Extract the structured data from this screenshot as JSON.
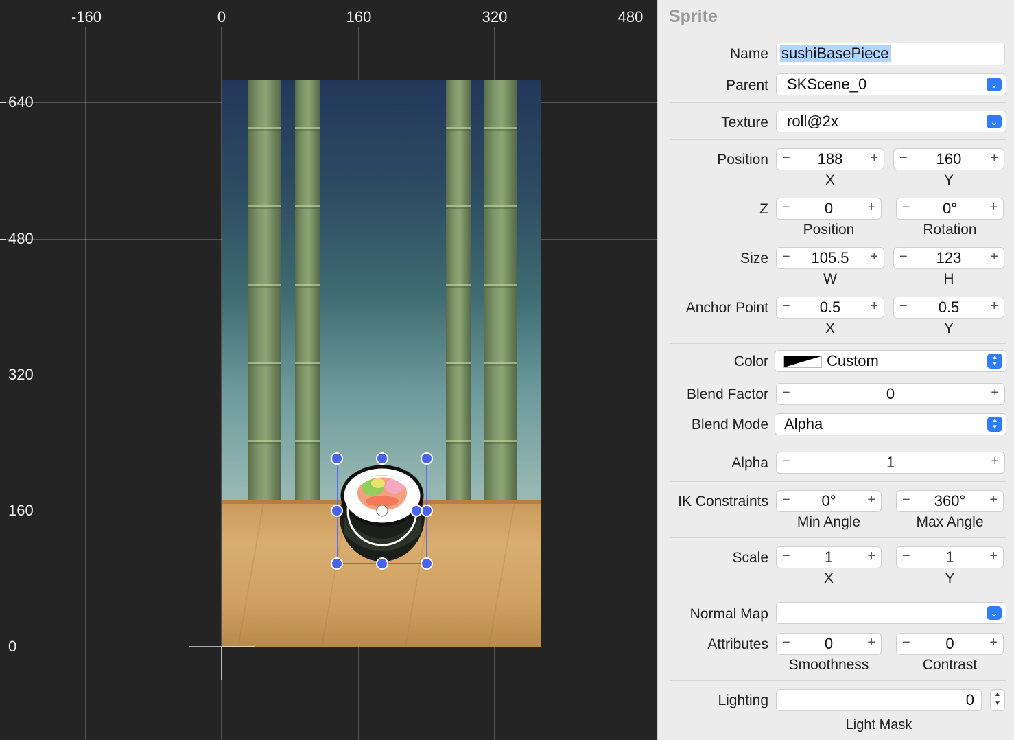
{
  "canvas": {
    "ruler_x": [
      "-160",
      "0",
      "160",
      "320",
      "480"
    ],
    "ruler_y": [
      "640",
      "480",
      "320",
      "160",
      "0"
    ]
  },
  "inspector": {
    "title": "Sprite",
    "name_label": "Name",
    "name_value": "sushiBasePiece",
    "parent_label": "Parent",
    "parent_value": "SKScene_0",
    "texture_label": "Texture",
    "texture_value": "roll@2x",
    "position_label": "Position",
    "position_x": "188",
    "position_y": "160",
    "x_label": "X",
    "y_label": "Y",
    "z_label": "Z",
    "z_position": "0",
    "z_rotation": "0°",
    "z_position_sub": "Position",
    "z_rotation_sub": "Rotation",
    "size_label": "Size",
    "size_w": "105.5",
    "size_h": "123",
    "w_label": "W",
    "h_label": "H",
    "anchor_label": "Anchor Point",
    "anchor_x": "0.5",
    "anchor_y": "0.5",
    "color_label": "Color",
    "color_value": "Custom",
    "blend_factor_label": "Blend Factor",
    "blend_factor_value": "0",
    "blend_mode_label": "Blend Mode",
    "blend_mode_value": "Alpha",
    "alpha_label": "Alpha",
    "alpha_value": "1",
    "ik_label": "IK Constraints",
    "ik_min": "0°",
    "ik_max": "360°",
    "ik_min_sub": "Min Angle",
    "ik_max_sub": "Max Angle",
    "scale_label": "Scale",
    "scale_x": "1",
    "scale_y": "1",
    "normal_map_label": "Normal Map",
    "normal_map_value": "",
    "attributes_label": "Attributes",
    "smoothness": "0",
    "contrast": "0",
    "smoothness_sub": "Smoothness",
    "contrast_sub": "Contrast",
    "lighting_label": "Lighting",
    "lighting_value": "0",
    "light_mask_sub": "Light Mask",
    "minus_glyph": "−",
    "plus_glyph": "+"
  },
  "colors": {
    "canvas_bg": "#242424",
    "selection": "#4a63ee",
    "accent": "#2f7cf6",
    "panel_bg": "#ececec"
  }
}
